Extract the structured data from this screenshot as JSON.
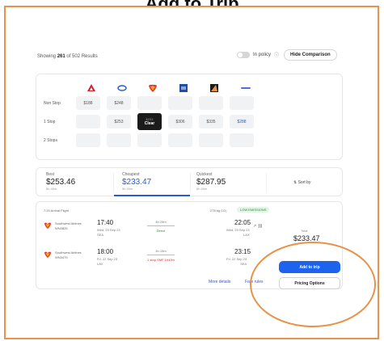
{
  "title": "Add to Trip",
  "header": {
    "showing_prefix": "Showing ",
    "showing_count": "261",
    "showing_suffix": " of 502 Results",
    "in_policy_label": "In policy",
    "info_glyph": "ⓘ",
    "hide_comparison_label": "Hide Comparison"
  },
  "matrix": {
    "rows": [
      {
        "label": "Non Stop",
        "cells": [
          "$188",
          "$248",
          "",
          "",
          "",
          ""
        ]
      },
      {
        "label": "1 Stop",
        "cells": [
          "",
          "$253",
          "$233",
          "$306",
          "$335",
          "$288"
        ]
      },
      {
        "label": "2 Stops",
        "cells": [
          "",
          "",
          "",
          "",
          "",
          ""
        ]
      }
    ],
    "selected": {
      "value": "$233",
      "action": "Clear"
    },
    "airlines": [
      "delta-logo",
      "united-logo",
      "southwest-logo",
      "alaska-logo",
      "frontier-logo",
      "spirit-logo"
    ]
  },
  "sort": {
    "options": [
      {
        "label": "Best",
        "price": "$253.46",
        "sub": "6h 40m"
      },
      {
        "label": "Cheapest",
        "price": "$233.47",
        "sub": "9h 40m"
      },
      {
        "label": "Quickest",
        "price": "$287.95",
        "sub": "6h 40m"
      }
    ],
    "sort_by_label": "Sort by"
  },
  "result": {
    "header": "7:20 Arrival Flight",
    "co2": "278 kg CO₂",
    "badge": "LOW EMISSIONS",
    "legs": [
      {
        "carrier": "Southwest Airlines",
        "flight": "WN3825",
        "depart_time": "17:40",
        "depart_date": "Wed, 20 Sep 23",
        "depart_code": "SEA",
        "duration": "4h 25m",
        "stops": "Direct",
        "arrive_time": "22:05",
        "arrive_date": "Wed, 20 Sep 23",
        "arrive_code": "LAX"
      },
      {
        "carrier": "Southwest Airlines",
        "flight": "WN3475",
        "depart_time": "18:00",
        "depart_date": "Fri, 22 Sep 23",
        "depart_code": "LAX",
        "duration": "4h 15m",
        "stops": "1 stop SMF 1h40m",
        "arrive_time": "23:15",
        "arrive_date": "Fri, 22 Sep 23",
        "arrive_code": "SEA"
      }
    ],
    "price_label": "Total",
    "price": "$233.47",
    "more_details": "More details",
    "fare_rules": "Fare rules",
    "add_to_trip": "Add to trip",
    "pricing_options": "Pricing Options"
  }
}
